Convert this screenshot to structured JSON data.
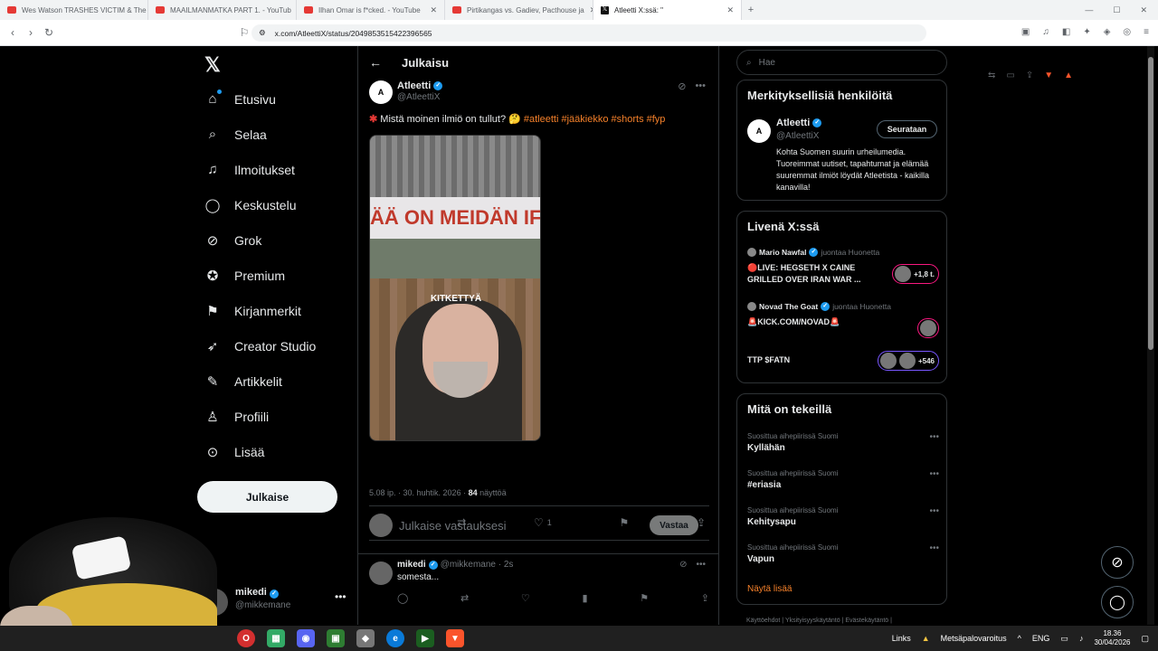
{
  "browser": {
    "tabs": [
      {
        "title": "Wes Watson TRASHES VICTIM & The",
        "icon": "youtube-icon"
      },
      {
        "title": "MAAILMANMATKA PART 1. - YouTub",
        "icon": "youtube-icon"
      },
      {
        "title": "Ilhan Omar is f*cked. - YouTube",
        "icon": "youtube-icon"
      },
      {
        "title": "Pirtikangas vs. Gadiev, Pacthouse ja",
        "icon": "youtube-icon"
      },
      {
        "title": "Atleetti X:ssä: \"",
        "icon": "x-icon"
      }
    ],
    "url": "x.com/AtleettiX/status/2049853515422396565"
  },
  "nav": {
    "items": [
      {
        "label": "Etusivu",
        "icon": "home-icon"
      },
      {
        "label": "Selaa",
        "icon": "search-icon"
      },
      {
        "label": "Ilmoitukset",
        "icon": "bell-icon"
      },
      {
        "label": "Keskustelu",
        "icon": "chat-icon"
      },
      {
        "label": "Grok",
        "icon": "grok-icon"
      },
      {
        "label": "Premium",
        "icon": "premium-icon"
      },
      {
        "label": "Kirjanmerkit",
        "icon": "bookmark-icon"
      },
      {
        "label": "Creator Studio",
        "icon": "rocket-icon"
      },
      {
        "label": "Artikkelit",
        "icon": "article-icon"
      },
      {
        "label": "Profiili",
        "icon": "profile-icon"
      },
      {
        "label": "Lisää",
        "icon": "more-icon"
      }
    ],
    "post_button": "Julkaise",
    "account": {
      "name": "mikedi",
      "handle": "@mikkemane"
    }
  },
  "main": {
    "header_title": "Julkaisu",
    "post": {
      "author": "Atleetti",
      "avatar_text": "A",
      "handle": "@AtleettiX",
      "text": "Mistä moinen ilmiö on tullut? 🤔",
      "hashtags": "#atleetti #jääkiekko #shorts #fyp",
      "media_banner": "ÄÄ ON MEIDÄN IFK",
      "media_caption": "KITKETTYÄ",
      "time": "5.08 ip. · 30. huhtik. 2026 ·",
      "views": "84",
      "views_label": "näyttöä",
      "replies": "1",
      "likes": "1"
    },
    "reply_placeholder": "Julkaise vastauksesi",
    "reply_button": "Vastaa",
    "comment": {
      "name": "mikedi",
      "handle": "@mikkemane · 2s",
      "text": "somesta..."
    }
  },
  "right": {
    "search_placeholder": "Hae",
    "relevant": {
      "title": "Merkityksellisiä henkilöitä",
      "name": "Atleetti",
      "avatar_text": "A",
      "handle": "@AtleettiX",
      "button": "Seurataan",
      "bio": "Kohta Suomen suurin urheilumedia. Tuoreimmat uutiset, tapahtumat ja elämää suuremmat ilmiöt löydät Atleetista - kaikilla kanavilla!"
    },
    "live": {
      "title": "Livenä X:ssä",
      "items": [
        {
          "host": "Mario Nawfal",
          "role": "juontaa Huonetta",
          "title": "🔴LIVE: HEGSETH X CAINE GRILLED OVER IRAN WAR ...",
          "count": "+1,8 t."
        },
        {
          "host": "Novad The Goat",
          "role": "juontaa Huonetta",
          "title": "🚨KICK.COM/NOVAD🚨",
          "count": ""
        },
        {
          "host": "",
          "role": "",
          "title": "TTP  $FATN",
          "count": "+546"
        }
      ]
    },
    "happening": {
      "title": "Mitä on tekeillä",
      "items": [
        {
          "category": "Suosittua aihepiirissä Suomi",
          "topic": "Kyllähän"
        },
        {
          "category": "Suosittua aihepiirissä Suomi",
          "topic": "#eriasia"
        },
        {
          "category": "Suosittua aihepiirissä Suomi",
          "topic": "Kehitysapu"
        },
        {
          "category": "Suosittua aihepiirissä Suomi",
          "topic": "Vapun"
        }
      ],
      "show_more": "Näytä lisää"
    },
    "footer": "Käyttöehdot  |  Yksityisyyskäytäntö  |  Evästekäytäntö  |"
  },
  "taskbar": {
    "links": "Links",
    "weather": "Metsäpalovaroitus",
    "lang": "ENG",
    "time": "18.36",
    "date": "30/04/2026"
  },
  "colors": {
    "accent": "#1d9bf0",
    "hashtag": "#f4802a",
    "live": "#f91880"
  }
}
